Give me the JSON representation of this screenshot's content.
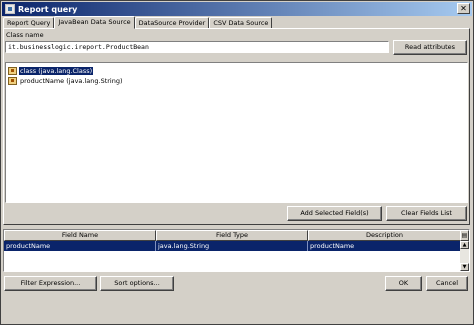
{
  "window": {
    "title": "Report query",
    "close_glyph": "✕"
  },
  "tabs": [
    {
      "label": "Report Query",
      "active": false
    },
    {
      "label": "JavaBean Data Source",
      "active": true
    },
    {
      "label": "DataSource Provider",
      "active": false
    },
    {
      "label": "CSV Data Source",
      "active": false
    }
  ],
  "bean": {
    "class_label": "Class name",
    "class_value": "it.businesslogic.ireport.ProductBean",
    "read_button": "Read attributes"
  },
  "tree": {
    "items": [
      {
        "label": "class (java.lang.Class)",
        "selected": true,
        "icon": "bean-attribute-icon"
      },
      {
        "label": "productName (java.lang.String)",
        "selected": false,
        "icon": "bean-attribute-icon"
      }
    ]
  },
  "field_buttons": {
    "add": "Add Selected Field(s)",
    "clear": "Clear Fields List"
  },
  "fields_table": {
    "columns": [
      "Field Name",
      "Field Type",
      "Description"
    ],
    "rows": [
      {
        "name": "productName",
        "type": "java.lang.String",
        "description": "productName",
        "selected": true
      }
    ]
  },
  "footer": {
    "filter": "Filter Expression...",
    "sort": "Sort options...",
    "ok": "OK",
    "cancel": "Cancel"
  },
  "colors": {
    "selection": "#0a246a",
    "face": "#d4d0c8"
  }
}
